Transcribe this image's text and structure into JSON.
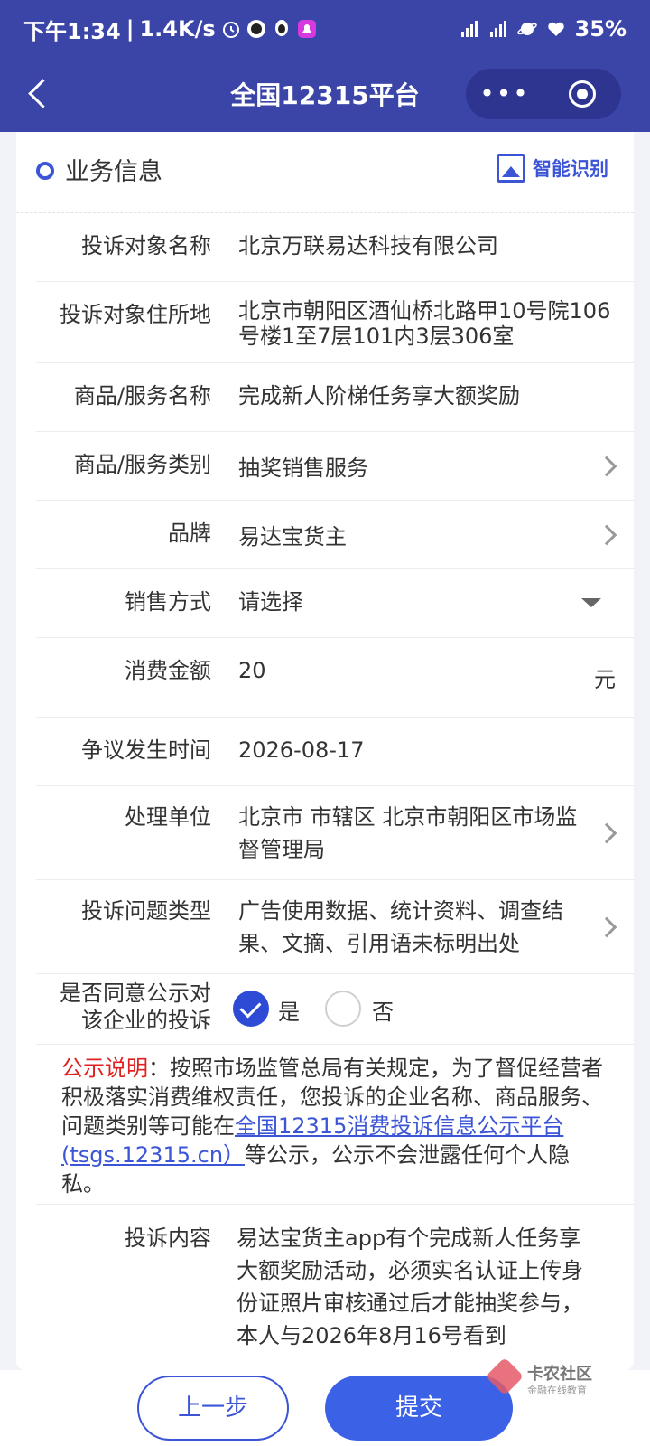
{
  "status_bar": {
    "time": "下午1:34",
    "speed": "1.4K/s",
    "battery": "35%",
    "icons": [
      "alarm-icon",
      "app-icon",
      "qq-icon",
      "bell-icon",
      "signal-icon",
      "signal-icon",
      "planet-icon",
      "heart-icon"
    ]
  },
  "nav": {
    "title": "全国12315平台",
    "more": "•••"
  },
  "section": {
    "title": "业务信息",
    "smart_label": "智能识别"
  },
  "fields": {
    "target_name": {
      "label": "投诉对象名称",
      "value": "北京万联易达科技有限公司"
    },
    "target_address": {
      "label": "投诉对象住所地",
      "value": "北京市朝阳区酒仙桥北路甲10号院106号楼1至7层101内3层306室"
    },
    "product_name": {
      "label": "商品/服务名称",
      "value": "完成新人阶梯任务享大额奖励"
    },
    "product_category": {
      "label": "商品/服务类别",
      "value": "抽奖销售服务"
    },
    "brand": {
      "label": "品牌",
      "value": "易达宝货主"
    },
    "sale_method": {
      "label": "销售方式",
      "placeholder": "请选择"
    },
    "amount": {
      "label": "消费金额",
      "value": "20",
      "unit": "元"
    },
    "dispute_time": {
      "label": "争议发生时间",
      "value": "2026-08-17"
    },
    "handler": {
      "label": "处理单位",
      "value": "北京市 市辖区 北京市朝阳区市场监督管理局"
    },
    "issue_type": {
      "label": "投诉问题类型",
      "value": "广告使用数据、统计资料、调查结果、文摘、引用语未标明出处"
    },
    "publicize": {
      "label_line1": "是否同意公示对",
      "label_line2": "该企业的投诉",
      "yes": "是",
      "no": "否",
      "selected": "是"
    }
  },
  "notice": {
    "head": "公示说明",
    "text1": "：按照市场监管总局有关规定，为了督促经营者积极落实消费维权责任，您投诉的企业名称、商品服务、问题类别等可能在",
    "link": "全国12315消费投诉信息公示平台(tsgs.12315.cn）",
    "text2": "等公示，公示不会泄露任何个人隐私。"
  },
  "complaint": {
    "label": "投诉内容",
    "value": "易达宝货主app有个完成新人任务享大额奖励活动，必须实名认证上传身份证照片审核通过后才能抽奖参与，本人与2026年8月16号看到"
  },
  "buttons": {
    "prev": "上一步",
    "submit": "提交"
  },
  "watermark": {
    "title": "卡农社区",
    "subtitle": "金融在线教育"
  },
  "colors": {
    "nav_bg": "#3b45a8",
    "accent": "#3b55d6",
    "notice_red": "#e02020"
  }
}
